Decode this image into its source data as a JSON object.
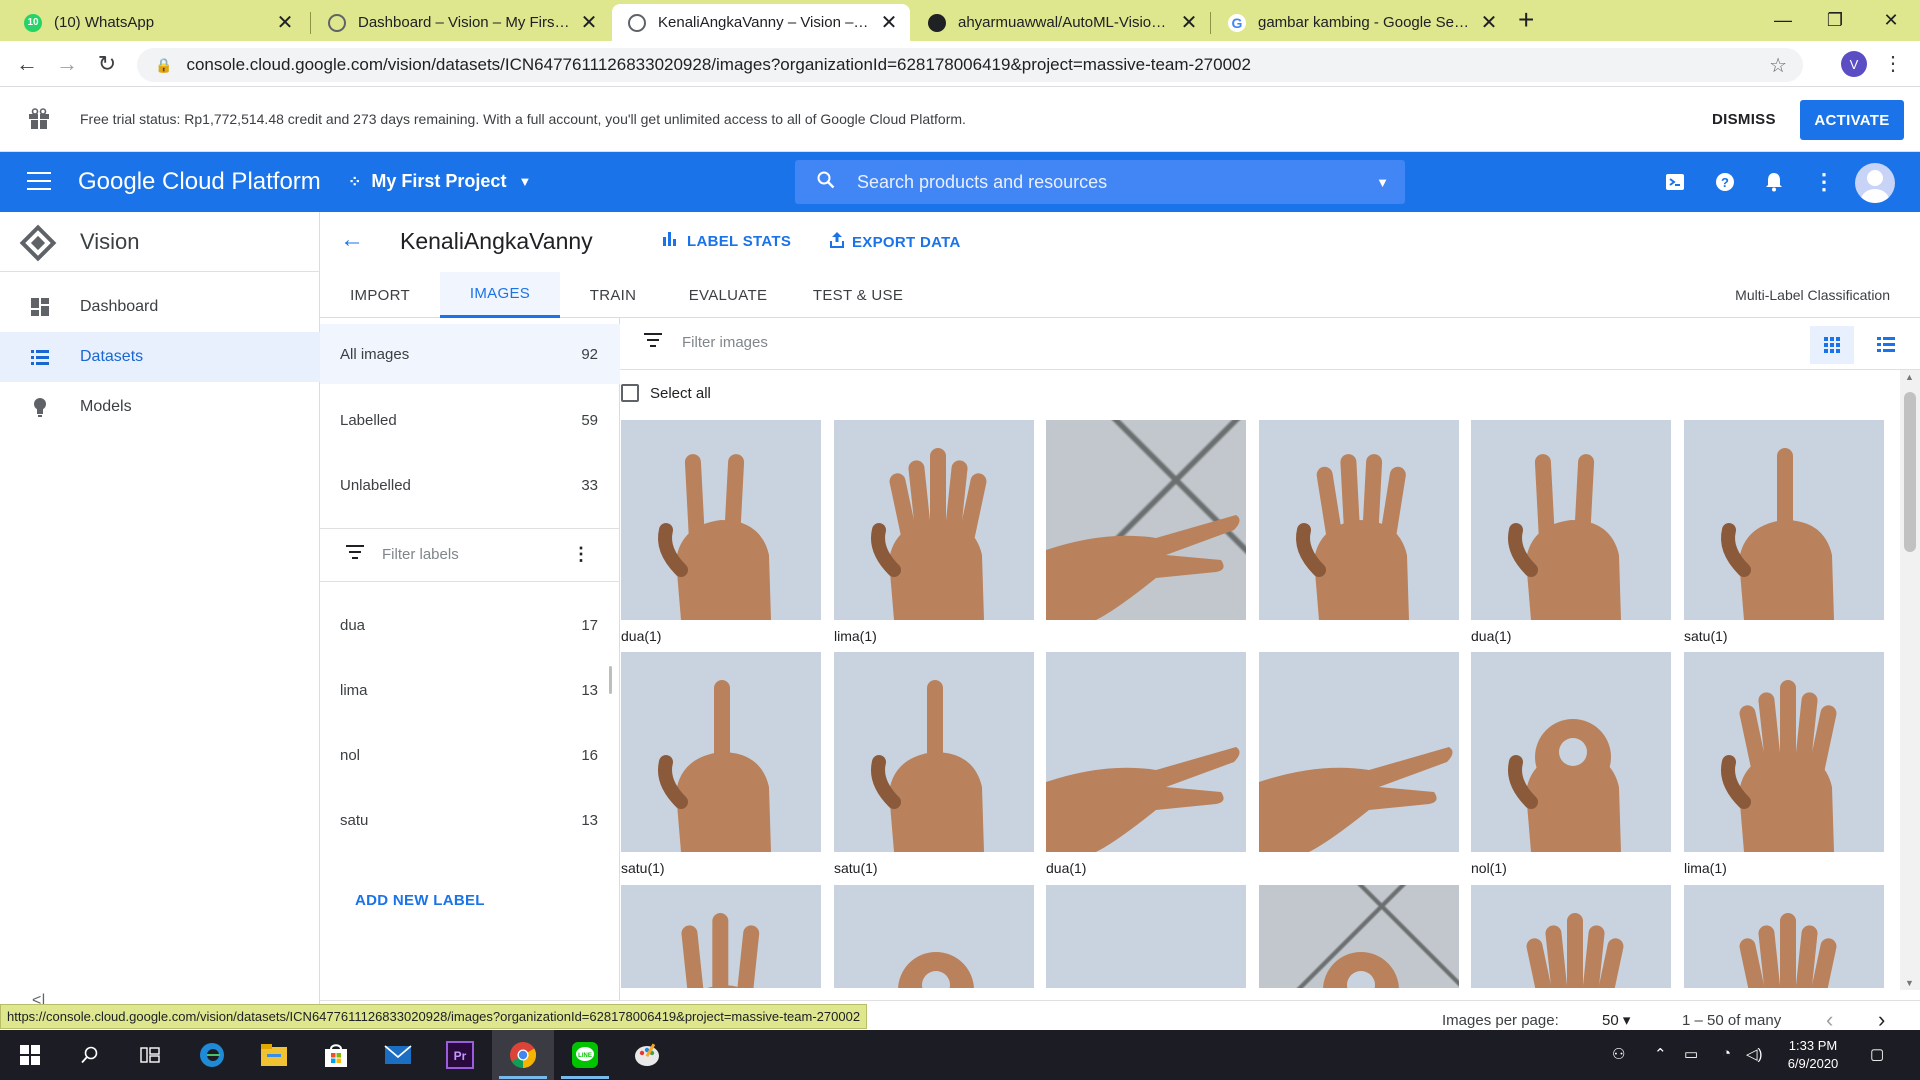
{
  "browser": {
    "tabs": [
      {
        "title": "(10) WhatsApp",
        "favicon": "whatsapp-icon",
        "color": "#25d366",
        "active": false
      },
      {
        "title": "Dashboard – Vision – My First Pr",
        "favicon": "gcp-icon",
        "color": "#5f6368",
        "active": false
      },
      {
        "title": "KenaliAngkaVanny – Vision – My",
        "favicon": "gcp-icon",
        "color": "#5f6368",
        "active": true
      },
      {
        "title": "ahyarmuawwal/AutoML-Vision-G",
        "favicon": "github-icon",
        "color": "#202124",
        "active": false
      },
      {
        "title": "gambar kambing - Google Searc",
        "favicon": "google-icon",
        "color": "#4285f4",
        "active": false
      }
    ],
    "url": "console.cloud.google.com/vision/datasets/ICN6477611126833020928/images?organizationId=628178006419&project=massive-team-270002",
    "profile_initial": "V",
    "status_url": "https://console.cloud.google.com/vision/datasets/ICN6477611126833020928/images?organizationId=628178006419&project=massive-team-270002"
  },
  "banner": {
    "message": "Free trial status: Rp1,772,514.48 credit and 273 days remaining. With a full account, you'll get unlimited access to all of Google Cloud Platform.",
    "dismiss": "DISMISS",
    "activate": "ACTIVATE"
  },
  "header": {
    "title": "Google Cloud Platform",
    "project": "My First Project",
    "search_placeholder": "Search products and resources"
  },
  "sidebar": {
    "product": "Vision",
    "items": [
      {
        "label": "Dashboard",
        "icon": "dashboard-icon",
        "active": false
      },
      {
        "label": "Datasets",
        "icon": "list-icon",
        "active": true
      },
      {
        "label": "Models",
        "icon": "bulb-icon",
        "active": false
      }
    ]
  },
  "dataset": {
    "name": "KenaliAngkaVanny",
    "label_stats": "LABEL STATS",
    "export_data": "EXPORT DATA",
    "tabs": [
      "IMPORT",
      "IMAGES",
      "TRAIN",
      "EVALUATE",
      "TEST & USE"
    ],
    "active_tab": "IMAGES",
    "type": "Multi-Label Classification"
  },
  "filters": {
    "groups": [
      {
        "label": "All images",
        "count": "92"
      },
      {
        "label": "Labelled",
        "count": "59"
      },
      {
        "label": "Unlabelled",
        "count": "33"
      }
    ],
    "filter_labels_placeholder": "Filter labels",
    "labels": [
      {
        "label": "dua",
        "count": "17"
      },
      {
        "label": "lima",
        "count": "13"
      },
      {
        "label": "nol",
        "count": "16"
      },
      {
        "label": "satu",
        "count": "13"
      }
    ],
    "add_label": "ADD NEW LABEL"
  },
  "grid": {
    "filter_placeholder": "Filter images",
    "select_all": "Select all",
    "rows": [
      [
        "dua(1)",
        "lima(1)",
        "",
        "",
        "dua(1)",
        "satu(1)"
      ],
      [
        "satu(1)",
        "satu(1)",
        "dua(1)",
        "",
        "nol(1)",
        "lima(1)"
      ],
      [
        "",
        "",
        "",
        "",
        "",
        ""
      ]
    ],
    "images": [
      [
        "two",
        "five",
        "floor-two",
        "four",
        "two",
        "one"
      ],
      [
        "one",
        "one",
        "side-two",
        "four-side",
        "zero",
        "five"
      ],
      [
        "three",
        "zero",
        "partial",
        "floor-fist",
        "five",
        "five"
      ]
    ]
  },
  "pagination": {
    "per_page_label": "Images per page:",
    "per_page": "50",
    "range": "1 – 50 of many"
  },
  "taskbar": {
    "time": "1:33 PM",
    "date": "6/9/2020"
  }
}
